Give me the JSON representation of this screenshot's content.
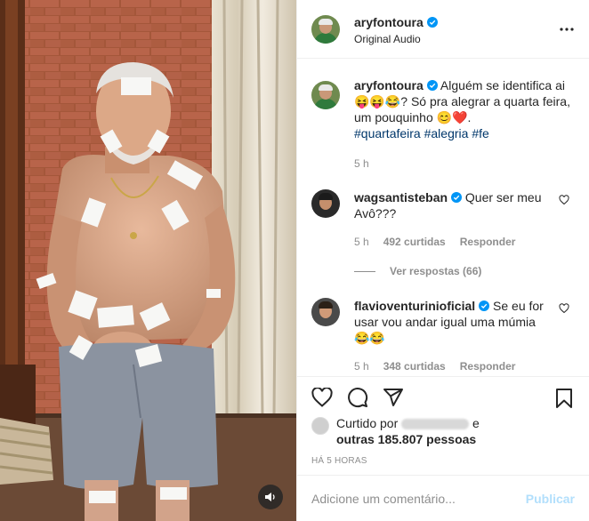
{
  "post": {
    "author": "aryfontoura",
    "audio": "Original Audio",
    "caption": {
      "author": "aryfontoura",
      "text": "Alguém se identifica ai 😝😝😂? Só pra alegrar a quarta feira, um pouquinho 😊❤️.",
      "hashtags": [
        "#quartafeira",
        "#alegria",
        "#fe"
      ],
      "time": "5 h"
    }
  },
  "comments": [
    {
      "author": "wagsantisteban",
      "text": "Quer ser meu Avô???",
      "time": "5 h",
      "likes": "492 curtidas",
      "reply": "Responder",
      "view_replies": "Ver respostas (66)"
    },
    {
      "author": "flavioventurinioficial",
      "text": "Se eu for usar vou andar igual uma múmia 😂😂",
      "time": "5 h",
      "likes": "348 curtidas",
      "reply": "Responder"
    }
  ],
  "likes_summary": {
    "prefix": "Curtido por",
    "conjunction": "e",
    "others": "outras 185.807 pessoas"
  },
  "time_ago": "HÁ 5 HORAS",
  "comment_box": {
    "placeholder": "Adicione um comentário...",
    "post_label": "Publicar"
  },
  "colors": {
    "verified": "#0095f6",
    "hashtag": "#00376b",
    "muted": "#8e8e8e",
    "publish_disabled": "#b2dffc"
  },
  "icons": {
    "audio": "speaker-icon",
    "more": "more-options-icon",
    "like": "heart-icon",
    "comment": "comment-icon",
    "share": "paper-plane-icon",
    "save": "bookmark-icon"
  }
}
